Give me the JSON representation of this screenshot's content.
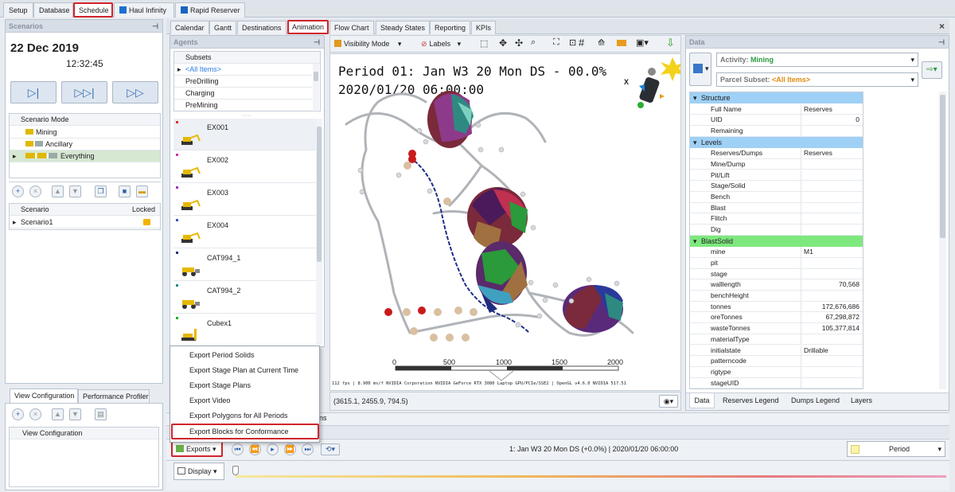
{
  "top_tabs": [
    "Setup",
    "Database",
    "Schedule",
    "Haul Infinity",
    "Rapid Reserver"
  ],
  "scenarios_panel": {
    "header": "Scenarios",
    "date": "22 Dec 2019",
    "time": "12:32:45",
    "mode_header": "Scenario Mode",
    "modes": [
      "Mining",
      "Ancillary",
      "Everything"
    ],
    "list_headers": [
      "Scenario",
      "Locked"
    ],
    "scenarios": [
      "Scenario1"
    ]
  },
  "view_config": {
    "tabs": [
      "View Configuration",
      "Performance Profiler"
    ],
    "column": "View Configuration"
  },
  "main_tabs": [
    "Calendar",
    "Gantt",
    "Destinations",
    "Animation",
    "Flow Chart",
    "Steady States",
    "Reporting",
    "KPIs"
  ],
  "agents_panel": {
    "header": "Agents",
    "subsets_header": "Subsets",
    "subsets": [
      "<All Items>",
      "PreDrilling",
      "Charging",
      "PreMining"
    ],
    "agents": [
      "EX001",
      "EX002",
      "EX003",
      "EX004",
      "CAT994_1",
      "CAT994_2",
      "Cubex1"
    ]
  },
  "viewport": {
    "visibility_mode": "Visibility Mode",
    "labels": "Labels",
    "period_line1": "Period 01: Jan W3 20 Mon DS - 00.0%",
    "period_line2": "2020/01/20 06:00:00",
    "axis_label": "X",
    "scale_ticks": [
      "0",
      "500",
      "1000",
      "1500",
      "2000"
    ],
    "fps_text": "112 fps | 8.900 ms/f    NVIDIA Corporation NVIDIA GeForce RTX 3080 Laptop GPU/PCIe/SSE2 | OpenGL v4.6.0 NVIDIA 517.51",
    "coords": "(3615.1, 2455.9, 794.5)"
  },
  "exports_menu": {
    "items": [
      "Export Period Solids",
      "Export Stage Plan at Current Time",
      "Export Stage Plans",
      "Export Video",
      "Export Polygons for All Periods",
      "Export Blocks for Conformance"
    ],
    "hidden_tab_fragment": "ns"
  },
  "playback": {
    "exports_label": "Exports",
    "display_label": "Display",
    "status": "1: Jan W3 20 Mon DS (+0.0%) | 2020/01/20 06:00:00",
    "period_select": "Period"
  },
  "data_panel": {
    "header": "Data",
    "activity_label": "Activity:",
    "activity_value": "Mining",
    "parcel_label": "Parcel Subset:",
    "parcel_value": "<All Items>",
    "sections": [
      {
        "name": "Structure",
        "color": "#9fd0f5",
        "rows": [
          [
            "Full Name",
            "Reserves"
          ],
          [
            "UID",
            "0"
          ],
          [
            "Remaining",
            ""
          ]
        ]
      },
      {
        "name": "Levels",
        "color": "#9fd0f5",
        "rows": [
          [
            "Reserves/Dumps",
            "Reserves"
          ],
          [
            "Mine/Dump",
            ""
          ],
          [
            "Pit/Lift",
            ""
          ],
          [
            "Stage/Solid",
            ""
          ],
          [
            "Bench",
            ""
          ],
          [
            "Blast",
            ""
          ],
          [
            "Flitch",
            ""
          ],
          [
            "Dig",
            ""
          ]
        ]
      },
      {
        "name": "BlastSolid",
        "color": "#7ee87e",
        "rows": [
          [
            "mine",
            "M1"
          ],
          [
            "pit",
            ""
          ],
          [
            "stage",
            ""
          ],
          [
            "walllength",
            "70,568"
          ],
          [
            "benchHeight",
            ""
          ],
          [
            "tonnes",
            "172,676,686"
          ],
          [
            "oreTonnes",
            "67,298,872"
          ],
          [
            "wasteTonnes",
            "105,377,814"
          ],
          [
            "materialType",
            ""
          ],
          [
            "initialstate",
            "Drillable"
          ],
          [
            "patterncode",
            ""
          ],
          [
            "rigtype",
            ""
          ],
          [
            "stageUID",
            ""
          ]
        ]
      }
    ],
    "bottom_tabs": [
      "Data",
      "Reserves Legend",
      "Dumps Legend",
      "Layers"
    ]
  }
}
